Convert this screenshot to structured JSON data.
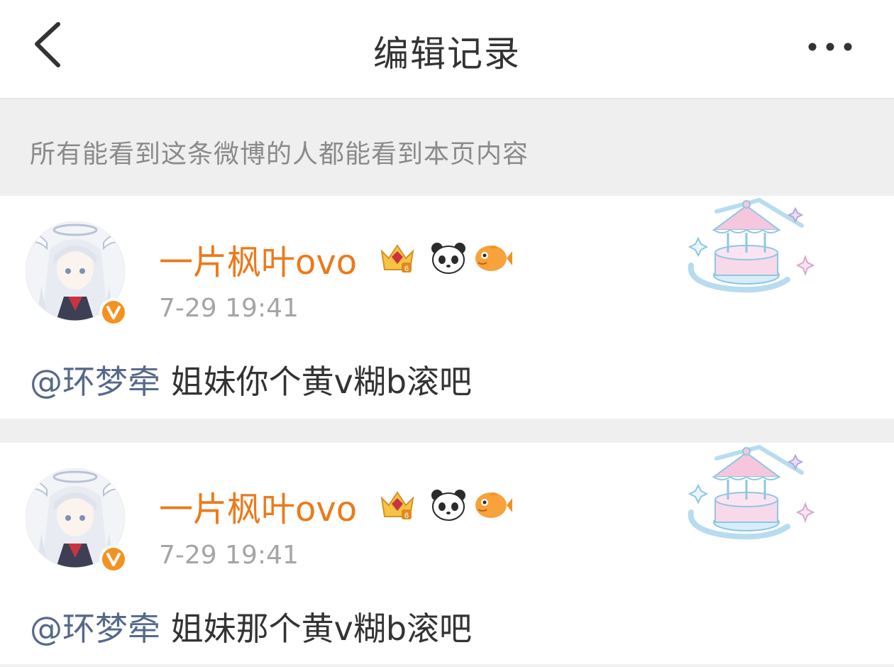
{
  "header": {
    "title": "编辑记录",
    "back_icon": "chevron-left-icon",
    "more_icon": "more-dots-icon"
  },
  "notice": {
    "text": "所有能看到这条微博的人都能看到本页内容"
  },
  "colors": {
    "username": "#ec7a1a",
    "mention": "#56698a",
    "text": "#333333",
    "muted": "#a5a5a5",
    "divider": "#efefef"
  },
  "records": [
    {
      "username": "一片枫叶ovo",
      "timestamp": "7-29 19:41",
      "mention": "@环梦牵",
      "content": " 姐妹你个黄v糊b滚吧",
      "badges": [
        "crown-level-6-icon",
        "panda-icon",
        "fish-icon"
      ],
      "verified_icon": "verified-v-icon",
      "decoration": "carousel-decoration-icon"
    },
    {
      "username": "一片枫叶ovo",
      "timestamp": "7-29 19:41",
      "mention": "@环梦牵",
      "content": " 姐妹那个黄v糊b滚吧",
      "badges": [
        "crown-level-6-icon",
        "panda-icon",
        "fish-icon"
      ],
      "verified_icon": "verified-v-icon",
      "decoration": "carousel-decoration-icon"
    }
  ]
}
